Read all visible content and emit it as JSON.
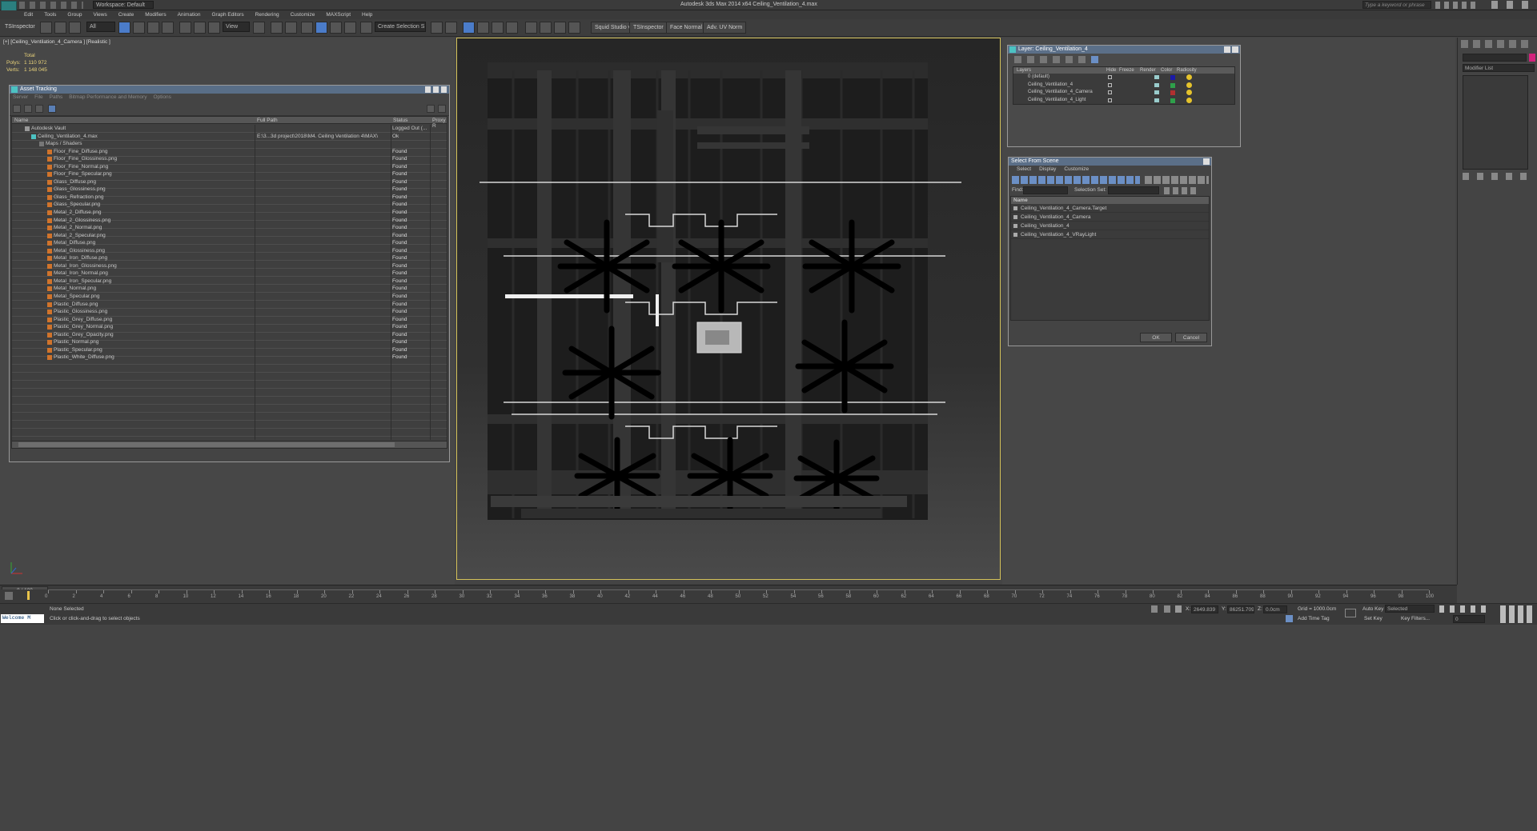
{
  "app": {
    "title": "Autodesk 3ds Max  2014 x64     Ceiling_Ventilation_4.max",
    "workspace": "Workspace: Default",
    "search_placeholder": "Type a keyword or phrase"
  },
  "menu": [
    "Edit",
    "Tools",
    "Group",
    "Views",
    "Create",
    "Modifiers",
    "Animation",
    "Graph Editors",
    "Rendering",
    "Customize",
    "MAXScript",
    "Help"
  ],
  "toolbar": {
    "left_label": "TSInspector",
    "filter": "All",
    "view": "View",
    "selection_set": "Create Selection S",
    "buttons": [
      "Squid Studio v",
      "TSInspector",
      "Face Normal",
      "Adv. UV Norm"
    ]
  },
  "viewport": {
    "label": "[+] [Ceiling_Ventilation_4_Camera ] [Realistic ]",
    "stats": {
      "total": "Total",
      "polys_label": "Polys:",
      "polys": "1 110 972",
      "verts_label": "Verts:",
      "verts": "1 148 045"
    }
  },
  "asset_tracking": {
    "title": "Asset Tracking",
    "menu": [
      "Server",
      "File",
      "Paths",
      "Bitmap Performance and Memory",
      "Options"
    ],
    "columns": [
      "Name",
      "Full Path",
      "Status",
      "Proxy R"
    ],
    "vault": {
      "name": "Autodesk Vault",
      "status": "Logged Out (..."
    },
    "max_file": {
      "name": "Ceiling_Ventilation_4.max",
      "path": "E:\\3...3d project\\2018\\M4. Ceiling Ventilation 4\\MAX\\",
      "status": "Ok"
    },
    "maps_group": "Maps / Shaders",
    "files": [
      {
        "name": "Floor_Fine_Diffuse.png",
        "status": "Found"
      },
      {
        "name": "Floor_Fine_Glossiness.png",
        "status": "Found"
      },
      {
        "name": "Floor_Fine_Normal.png",
        "status": "Found"
      },
      {
        "name": "Floor_Fine_Specular.png",
        "status": "Found"
      },
      {
        "name": "Glass_Diffuse.png",
        "status": "Found"
      },
      {
        "name": "Glass_Glossiness.png",
        "status": "Found"
      },
      {
        "name": "Glass_Refraction.png",
        "status": "Found"
      },
      {
        "name": "Glass_Specular.png",
        "status": "Found"
      },
      {
        "name": "Metal_2_Diffuse.png",
        "status": "Found"
      },
      {
        "name": "Metal_2_Glossiness.png",
        "status": "Found"
      },
      {
        "name": "Metal_2_Normal.png",
        "status": "Found"
      },
      {
        "name": "Metal_2_Specular.png",
        "status": "Found"
      },
      {
        "name": "Metal_Diffuse.png",
        "status": "Found"
      },
      {
        "name": "Metal_Glossiness.png",
        "status": "Found"
      },
      {
        "name": "Metal_Iron_Diffuse.png",
        "status": "Found"
      },
      {
        "name": "Metal_Iron_Glossiness.png",
        "status": "Found"
      },
      {
        "name": "Metal_Iron_Normal.png",
        "status": "Found"
      },
      {
        "name": "Metal_Iron_Specular.png",
        "status": "Found"
      },
      {
        "name": "Metal_Normal.png",
        "status": "Found"
      },
      {
        "name": "Metal_Specular.png",
        "status": "Found"
      },
      {
        "name": "Plastic_Diffuse.png",
        "status": "Found"
      },
      {
        "name": "Plastic_Glossiness.png",
        "status": "Found"
      },
      {
        "name": "Plastic_Grey_Diffuse.png",
        "status": "Found"
      },
      {
        "name": "Plastic_Grey_Normal.png",
        "status": "Found"
      },
      {
        "name": "Plastic_Grey_Opacity.png",
        "status": "Found"
      },
      {
        "name": "Plastic_Normal.png",
        "status": "Found"
      },
      {
        "name": "Plastic_Specular.png",
        "status": "Found"
      },
      {
        "name": "Plastic_White_Diffuse.png",
        "status": "Found"
      }
    ]
  },
  "layer_manager": {
    "title": "Layer: Ceiling_Ventilation_4",
    "columns": [
      "Layers",
      "Hide",
      "Freeze",
      "Render",
      "Color",
      "Radiosity"
    ],
    "layers": [
      {
        "name": "0 (default)",
        "color": "#1a1aa8"
      },
      {
        "name": "Ceiling_Ventilation_4",
        "color": "#2ea04a"
      },
      {
        "name": "Ceiling_Ventilation_4_Camera",
        "color": "#b03030"
      },
      {
        "name": "Ceiling_Ventilation_4_Light",
        "color": "#2ea04a"
      }
    ]
  },
  "select_from_scene": {
    "title": "Select From Scene",
    "menu": [
      "Select",
      "Display",
      "Customize"
    ],
    "find_label": "Find:",
    "selection_set_label": "Selection Set:",
    "column": "Name",
    "items": [
      "Ceiling_Ventilation_4_Camera.Target",
      "Ceiling_Ventilation_4_Camera",
      "Ceiling_Ventilation_4",
      "Ceiling_Ventilation_4_VRayLight"
    ],
    "ok": "OK",
    "cancel": "Cancel"
  },
  "command_panel": {
    "modifier_list": "Modifier List"
  },
  "timeline": {
    "frame_indicator": "0 / 100",
    "ticks": [
      "0",
      "2",
      "4",
      "6",
      "8",
      "10",
      "12",
      "14",
      "16",
      "18",
      "20",
      "22",
      "24",
      "26",
      "28",
      "30",
      "32",
      "34",
      "36",
      "38",
      "40",
      "42",
      "44",
      "46",
      "48",
      "50",
      "52",
      "54",
      "56",
      "58",
      "60",
      "62",
      "64",
      "66",
      "68",
      "70",
      "72",
      "74",
      "76",
      "78",
      "80",
      "82",
      "84",
      "86",
      "88",
      "90",
      "92",
      "94",
      "96",
      "98",
      "100"
    ]
  },
  "status": {
    "maxscript": "Welcome M",
    "selection": "None Selected",
    "prompt": "Click or click-and-drag to select objects",
    "x_label": "X:",
    "x": "2649.839",
    "y_label": "Y:",
    "y": "86251.709",
    "z_label": "Z:",
    "z": "0.0cm",
    "grid": "Grid = 1000.0cm",
    "auto_key": "Auto Key",
    "selected": "Selected",
    "set_key": "Set Key",
    "key_filters": "Key Filters...",
    "add_time_tag": "Add Time Tag",
    "frame": "0"
  }
}
